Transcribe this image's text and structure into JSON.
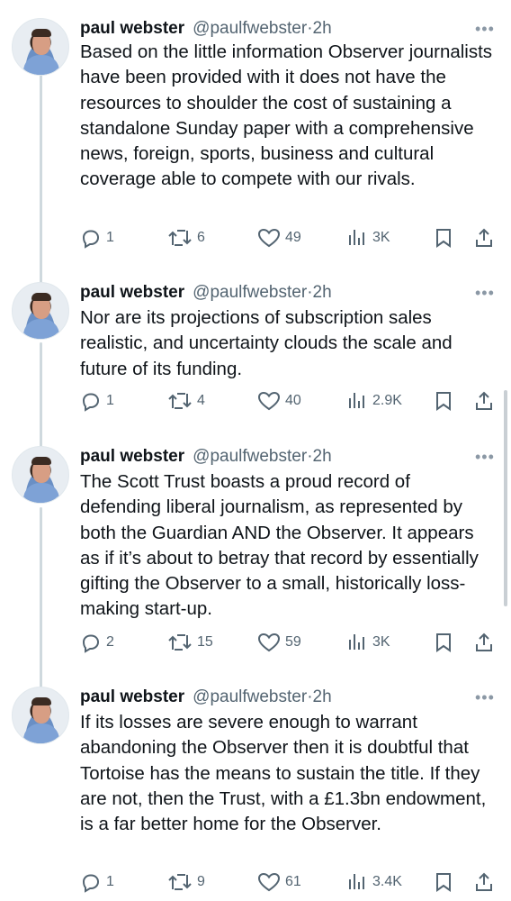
{
  "tweets": [
    {
      "name": "paul webster",
      "handle": "@paulfwebster",
      "time": "2h",
      "text": "Based on the little information Observer journalists have been provided with it does not have the resources to shoulder the cost of sustaining a standalone Sunday paper with a comprehensive news, foreign, sports, business and cultural coverage able to compete with our rivals.",
      "replies": "1",
      "retweets": "6",
      "likes": "49",
      "views": "3K"
    },
    {
      "name": "paul webster",
      "handle": "@paulfwebster",
      "time": "2h",
      "text": "Nor are its projections of subscription sales realistic, and uncertainty clouds the scale and future of its funding.",
      "replies": "1",
      "retweets": "4",
      "likes": "40",
      "views": "2.9K"
    },
    {
      "name": "paul webster",
      "handle": "@paulfwebster",
      "time": "2h",
      "text": "The Scott Trust boasts a proud record of defending liberal journalism, as represented by both the Guardian AND the Observer. It appears as if it’s about to betray that record by essentially gifting the Observer to a small, historically loss-making start-up.",
      "replies": "2",
      "retweets": "15",
      "likes": "59",
      "views": "3K"
    },
    {
      "name": "paul webster",
      "handle": "@paulfwebster",
      "time": "2h",
      "text": "If its losses are severe enough to warrant abandoning the Observer then it is doubtful that Tortoise has the means to sustain the title. If they are not, then the Trust, with a £1.3bn endowment, is a far better home for the Observer.",
      "replies": "1",
      "retweets": "9",
      "likes": "61",
      "views": "3.4K"
    }
  ],
  "more_label": "•••",
  "dot": "·",
  "icons": [
    "reply-icon",
    "retweet-icon",
    "like-icon",
    "views-icon",
    "bookmark-icon",
    "share-icon"
  ],
  "colors": {
    "text": "#0f1419",
    "secondary": "#536471",
    "thread": "#cfd9de"
  }
}
